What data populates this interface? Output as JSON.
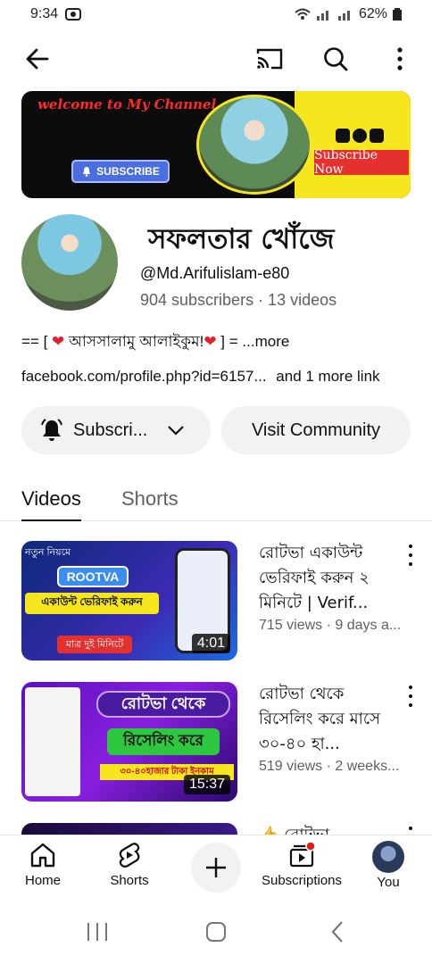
{
  "status": {
    "time": "9:34",
    "battery": "62%"
  },
  "icons": {
    "back": "arrow-left-icon",
    "cast": "cast-icon",
    "search": "search-icon",
    "more": "more-vert-icon"
  },
  "banner": {
    "welcome": "welcome to My Channel",
    "subscribe_button": "SUBSCRIBE",
    "subscribe_now": "Subscribe Now"
  },
  "channel": {
    "name": "সফলতার খোঁজে",
    "handle": "@Md.Arifulislam-e80",
    "stats": "904 subscribers · 13 videos",
    "about_prefix": "== [ ",
    "about_text": "আসসালামু আলাইকুম!",
    "about_suffix": " ] = ",
    "about_more": "...more",
    "link": "facebook.com/profile.php?id=6157...",
    "more_links": "and 1 more link"
  },
  "actions": {
    "subscribe": "Subscri...",
    "visit": "Visit Community"
  },
  "tabs": [
    {
      "label": "Videos"
    },
    {
      "label": "Shorts"
    }
  ],
  "videos": [
    {
      "title": "রোটভা একাউন্ট ভেরিফাই করুন ২ মিনিটে | Verif...",
      "meta": "715 views · 9 days a...",
      "duration": "4:01",
      "thumb_text_1": "নতুন নিয়মে",
      "thumb_text_2": "ROOTVA",
      "thumb_text_3": "একাউন্ট ভেরিফাই করুন",
      "thumb_text_4": "মাত্র দুই মিনিটে"
    },
    {
      "title": "রোটভা থেকে রিসেলিং করে মাসে ৩০-৪০ হা...",
      "meta": "519 views · 2 weeks...",
      "duration": "15:37",
      "thumb_text_1": "রোটভা থেকে",
      "thumb_text_2": "রিসেলিং করে",
      "thumb_text_3": "৩০-৪০হাজার টাকা ইনকাম"
    },
    {
      "title": "👍 রোটভা",
      "meta": "",
      "duration": ""
    }
  ],
  "nav": [
    {
      "label": "Home",
      "icon": "home-icon"
    },
    {
      "label": "Shorts",
      "icon": "shorts-icon"
    },
    {
      "label": "",
      "icon": "plus-icon"
    },
    {
      "label": "Subscriptions",
      "icon": "subscriptions-icon"
    },
    {
      "label": "You",
      "icon": "avatar-icon"
    }
  ],
  "colors": {
    "accent": "#ff0000",
    "text": "#0f0f0f",
    "muted": "#606060",
    "chip": "#f2f2f2"
  }
}
